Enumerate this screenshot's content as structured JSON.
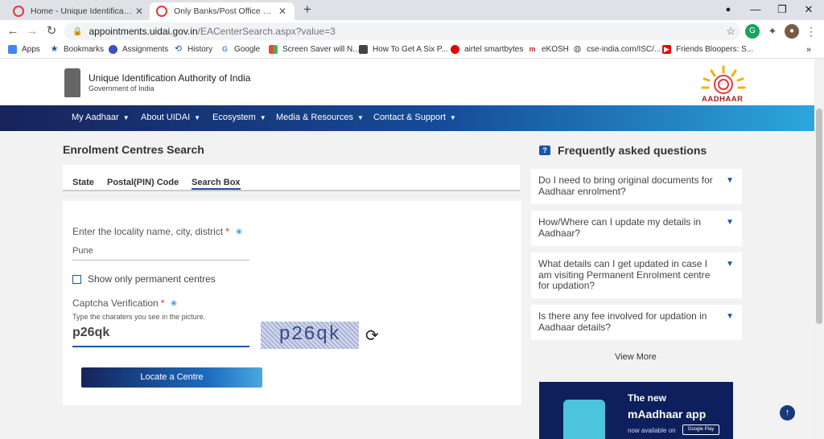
{
  "browser": {
    "tabs": [
      {
        "title": "Home - Unique Identification Au",
        "active": false
      },
      {
        "title": "Only Banks/Post Office Enrolmen",
        "active": true
      }
    ],
    "address": {
      "host": "appointments.uidai.gov.in",
      "path": "/EACenterSearch.aspx?value=3"
    },
    "bookmarks": [
      "Apps",
      "Bookmarks",
      "Assignments",
      "History",
      "Google",
      "Screen Saver will N...",
      "How To Get A Six P...",
      "airtel smartbytes",
      "eKOSH",
      "cse-india.com/ISC/...",
      "Friends Bloopers: S..."
    ]
  },
  "header": {
    "org_name": "Unique Identification Authority of India",
    "org_sub": "Government of India",
    "logo_text": "AADHAAR"
  },
  "nav": [
    "My Aadhaar",
    "About UIDAI",
    "Ecosystem",
    "Media & Resources",
    "Contact & Support"
  ],
  "main": {
    "title": "Enrolment Centres Search",
    "tabs": [
      "State",
      "Postal(PIN) Code",
      "Search Box"
    ],
    "active_tab": "Search Box",
    "locality_label": "Enter the locality name, city, district",
    "locality_value": "Pune",
    "permanent_label": "Show only permanent centres",
    "captcha_label": "Captcha Verification",
    "captcha_hint": "Type the charaters you see in the picture.",
    "captcha_value": "p26qk",
    "captcha_image_text": "p26qk",
    "locate_button": "Locate a Centre",
    "required_mark": "*"
  },
  "faq": {
    "title": "Frequently asked questions",
    "items": [
      "Do I need to bring original documents for Aadhaar enrolment?",
      "How/Where can I update my details in Aadhaar?",
      "What details can I get updated in case I am visiting Permanent Enrolment centre for updation?",
      "Is there any fee involved for updation in Aadhaar details?"
    ],
    "view_more": "View More"
  },
  "promo": {
    "line1": "The new",
    "line2": "mAadhaar app",
    "line3": "now available on",
    "store": "Google Play"
  },
  "colors": {
    "nav_start": "#17235a",
    "nav_end": "#2ba7dd",
    "accent": "#1a56a8",
    "required": "#d32f2f"
  }
}
